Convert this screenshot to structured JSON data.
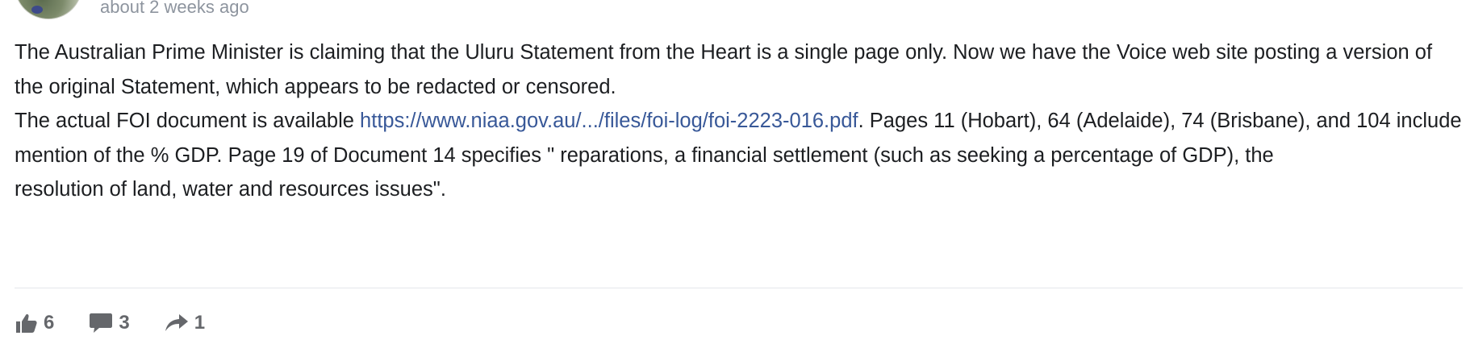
{
  "post": {
    "timestamp": "about 2 weeks ago",
    "paragraph_1": "The Australian Prime Minister is claiming that the Uluru Statement from the Heart is a single page only. Now we have the Voice web site posting a version of the original Statement, which appears to be redacted or censored.",
    "paragraph_2_prefix": "The actual FOI document is available ",
    "paragraph_2_link": "https://www.niaa.gov.au/.../files/foi-log/foi-2223-016.pdf",
    "paragraph_2_suffix": ". Pages 11 (Hobart), 64 (Adelaide), 74 (Brisbane), and 104 include mention of the % GDP. Page 19 of Document 14 specifies \" reparations, a financial settlement (such as seeking a percentage of GDP), the",
    "paragraph_3": "resolution of land, water and resources issues\"."
  },
  "actions": {
    "likes": "6",
    "comments": "3",
    "shares": "1"
  },
  "icons": {
    "like": "thumbs-up-icon",
    "comment": "speech-bubble-icon",
    "share": "share-arrow-icon"
  },
  "colors": {
    "link": "#385898",
    "text": "#1c1e21",
    "muted": "#8d949e",
    "action": "#65676b"
  }
}
